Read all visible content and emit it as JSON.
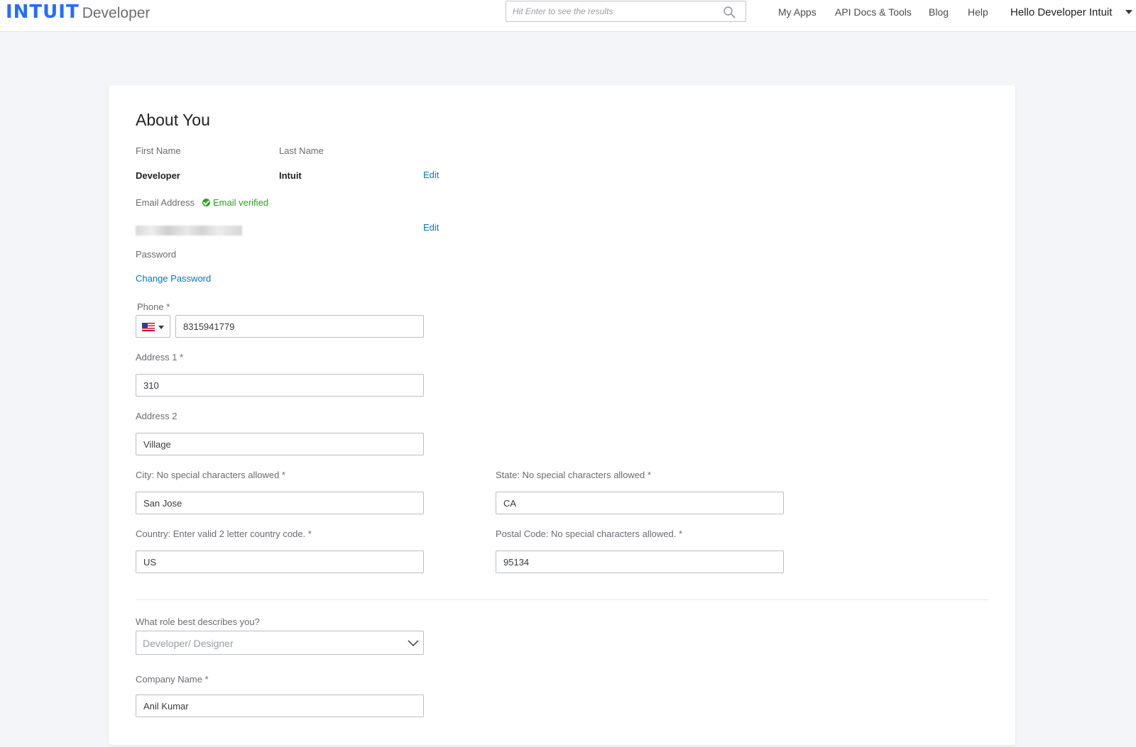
{
  "header": {
    "logo_brand": "INTUIT",
    "logo_product": "Developer",
    "search_placeholder": "Hit Enter to see the results",
    "nav": {
      "my_apps": "My Apps",
      "api_docs": "API Docs & Tools",
      "blog": "Blog",
      "help": "Help",
      "user": "Hello Developer Intuit"
    },
    "brand_color": "#236cff"
  },
  "card": {
    "title": "About You",
    "first_name_label": "First Name",
    "first_name_value": "Developer",
    "last_name_label": "Last Name",
    "last_name_value": "Intuit",
    "edit_name_link": "Edit",
    "email_label": "Email Address",
    "email_verified": "Email verified",
    "edit_email_link": "Edit",
    "password_label": "Password",
    "change_password_link": "Change Password",
    "phone_label": "Phone *",
    "phone_country_icon": "us-flag-icon",
    "phone_value": "8315941779",
    "address1_label": "Address 1 *",
    "address1_value": "310",
    "address2_label": "Address 2",
    "address2_value": "Village",
    "city_label": "City: No special characters allowed *",
    "city_value": "San Jose",
    "state_label": "State: No special characters allowed *",
    "state_value": "CA",
    "country_label": "Country: Enter valid 2 letter country code. *",
    "country_value": "US",
    "postal_label": "Postal Code: No special characters allowed. *",
    "postal_value": "95134",
    "role_label": "What role best describes you?",
    "role_value": "Developer/ Designer",
    "company_label": "Company Name *",
    "company_value": "Anil Kumar"
  },
  "colors": {
    "link": "#0077c5",
    "verified": "#2ca01c",
    "background": "#f4f5f8"
  }
}
